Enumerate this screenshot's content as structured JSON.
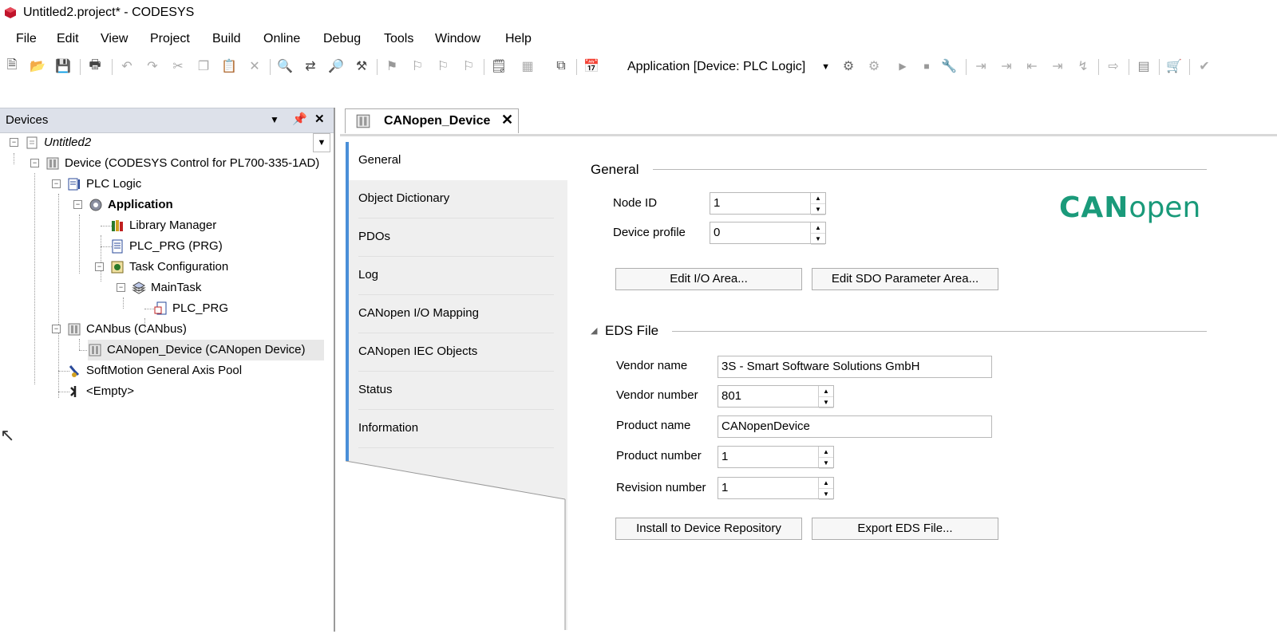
{
  "window": {
    "title": "Untitled2.project* - CODESYS"
  },
  "menu": [
    "File",
    "Edit",
    "View",
    "Project",
    "Build",
    "Online",
    "Debug",
    "Tools",
    "Window",
    "Help"
  ],
  "toolbar": {
    "app_selector": "Application [Device: PLC Logic]"
  },
  "devices_panel": {
    "title": "Devices",
    "tree": [
      {
        "label": "Untitled2"
      },
      {
        "label": "Device (CODESYS Control for PL700-335-1AD)"
      },
      {
        "label": "PLC Logic"
      },
      {
        "label": "Application"
      },
      {
        "label": "Library Manager"
      },
      {
        "label": "PLC_PRG (PRG)"
      },
      {
        "label": "Task Configuration"
      },
      {
        "label": "MainTask"
      },
      {
        "label": "PLC_PRG"
      },
      {
        "label": "CANbus (CANbus)"
      },
      {
        "label": "CANopen_Device (CANopen Device)"
      },
      {
        "label": "SoftMotion General Axis Pool"
      },
      {
        "label": "<Empty>"
      }
    ]
  },
  "editor": {
    "tab_label": "CANopen_Device",
    "side_tabs": [
      "General",
      "Object Dictionary",
      "PDOs",
      "Log",
      "CANopen I/O Mapping",
      "CANopen IEC Objects",
      "Status",
      "Information"
    ],
    "general": {
      "section_title": "General",
      "node_id_label": "Node ID",
      "node_id_value": "1",
      "device_profile_label": "Device profile",
      "device_profile_value": "0",
      "edit_io_button": "Edit I/O Area...",
      "edit_sdo_button": "Edit SDO Parameter Area...",
      "logo_text_bold": "CAN",
      "logo_text_light": "open"
    },
    "eds": {
      "section_title": "EDS File",
      "vendor_name_label": "Vendor name",
      "vendor_name_value": "3S - Smart Software Solutions GmbH",
      "vendor_number_label": "Vendor number",
      "vendor_number_value": "801",
      "product_name_label": "Product name",
      "product_name_value": "CANopenDevice",
      "product_number_label": "Product number",
      "product_number_value": "1",
      "revision_number_label": "Revision number",
      "revision_number_value": "1",
      "install_button": "Install to Device Repository",
      "export_button": "Export EDS File..."
    }
  },
  "colors": {
    "accent_tab_bar": "#4a8fd8",
    "logo": "#1a9a7a",
    "panel_header": "#dde1ea"
  }
}
